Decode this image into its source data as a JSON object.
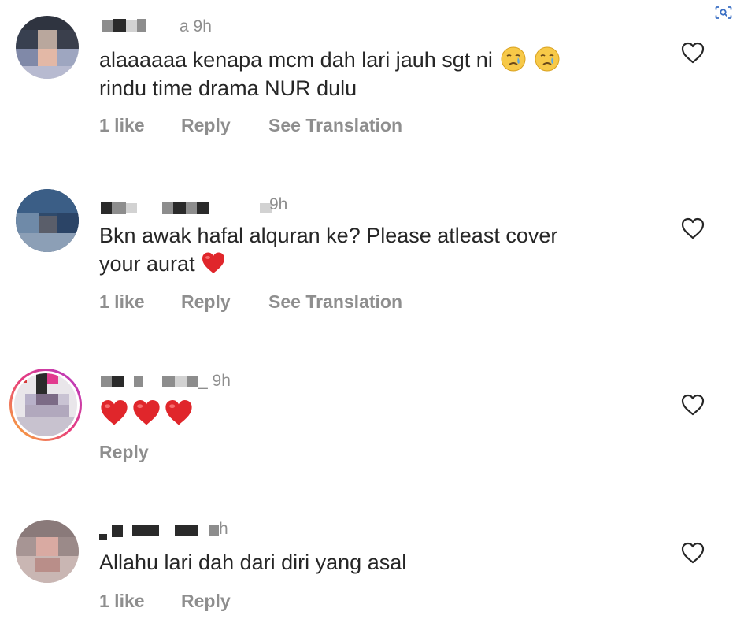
{
  "comments": [
    {
      "time": "a 9h",
      "text_line1": "alaaaaaa kenapa mcm dah lari jauh sgt ni",
      "text_line2": "rindu time drama NUR dulu",
      "emojis": [
        "crying-face",
        "crying-face"
      ],
      "likes": "1 like",
      "reply": "Reply",
      "translate": "See Translation"
    },
    {
      "time": "9h",
      "text_line1": "Bkn awak hafal alquran ke? Please atleast cover",
      "text_line2": "your aurat",
      "emojis": [
        "red-heart"
      ],
      "likes": "1 like",
      "reply": "Reply",
      "translate": "See Translation"
    },
    {
      "time": "_ 9h",
      "emojis": [
        "red-heart",
        "red-heart",
        "red-heart"
      ],
      "reply": "Reply"
    },
    {
      "time": "h",
      "text_line1": "Allahu lari dah dari diri yang asal",
      "likes": "1 like",
      "reply": "Reply"
    }
  ],
  "colors": {
    "text": "#262626",
    "muted": "#8e8e8e",
    "heart_red": "#e0262b"
  },
  "icons": [
    "lens-icon",
    "heart-outline-icon",
    "crying-face-emoji",
    "red-heart-emoji"
  ]
}
